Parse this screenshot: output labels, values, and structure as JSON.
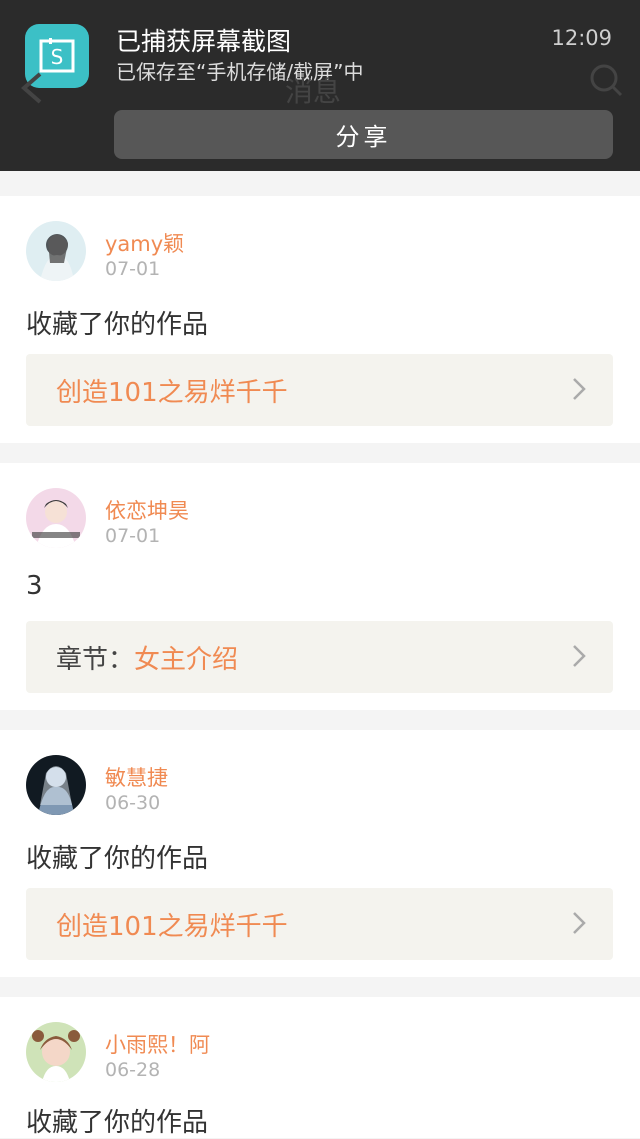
{
  "notification": {
    "title": "已捕获屏幕截图",
    "subtitle": "已保存至“手机存储/截屏”中",
    "time": "12:09",
    "share_label": "分享",
    "app_icon": "screenshot-app-icon"
  },
  "background_header": {
    "title": "消息",
    "back_icon": "back-chevron-icon",
    "search_icon": "search-icon"
  },
  "feed": [
    {
      "username": "yamy颖",
      "date": "07-01",
      "message": "收藏了你的作品",
      "ref_prefix": "",
      "ref_title": "创造101之易烊千千",
      "avatar_colors": [
        "#dfeef2",
        "#5a5a5a"
      ]
    },
    {
      "username": "依恋坤昊",
      "date": "07-01",
      "message": "3",
      "ref_prefix": "章节：",
      "ref_title": "女主介绍",
      "avatar_colors": [
        "#f3d9e8",
        "#3b3b3b"
      ]
    },
    {
      "username": "敏慧捷",
      "date": "06-30",
      "message": "收藏了你的作品",
      "ref_prefix": "",
      "ref_title": "创造101之易烊千千",
      "avatar_colors": [
        "#111a22",
        "#c8d7e6"
      ]
    },
    {
      "username": "小雨熙！阿",
      "date": "06-28",
      "message": "收藏了你的作品",
      "ref_prefix": "",
      "ref_title": "",
      "avatar_colors": [
        "#cfe3b8",
        "#f4d7c8"
      ]
    }
  ],
  "colors": {
    "accent": "#f08a52",
    "ref_bg": "#f4f3ee",
    "notification_bg": "#2b2b2b",
    "app_icon_bg": "#3cc0c6"
  }
}
